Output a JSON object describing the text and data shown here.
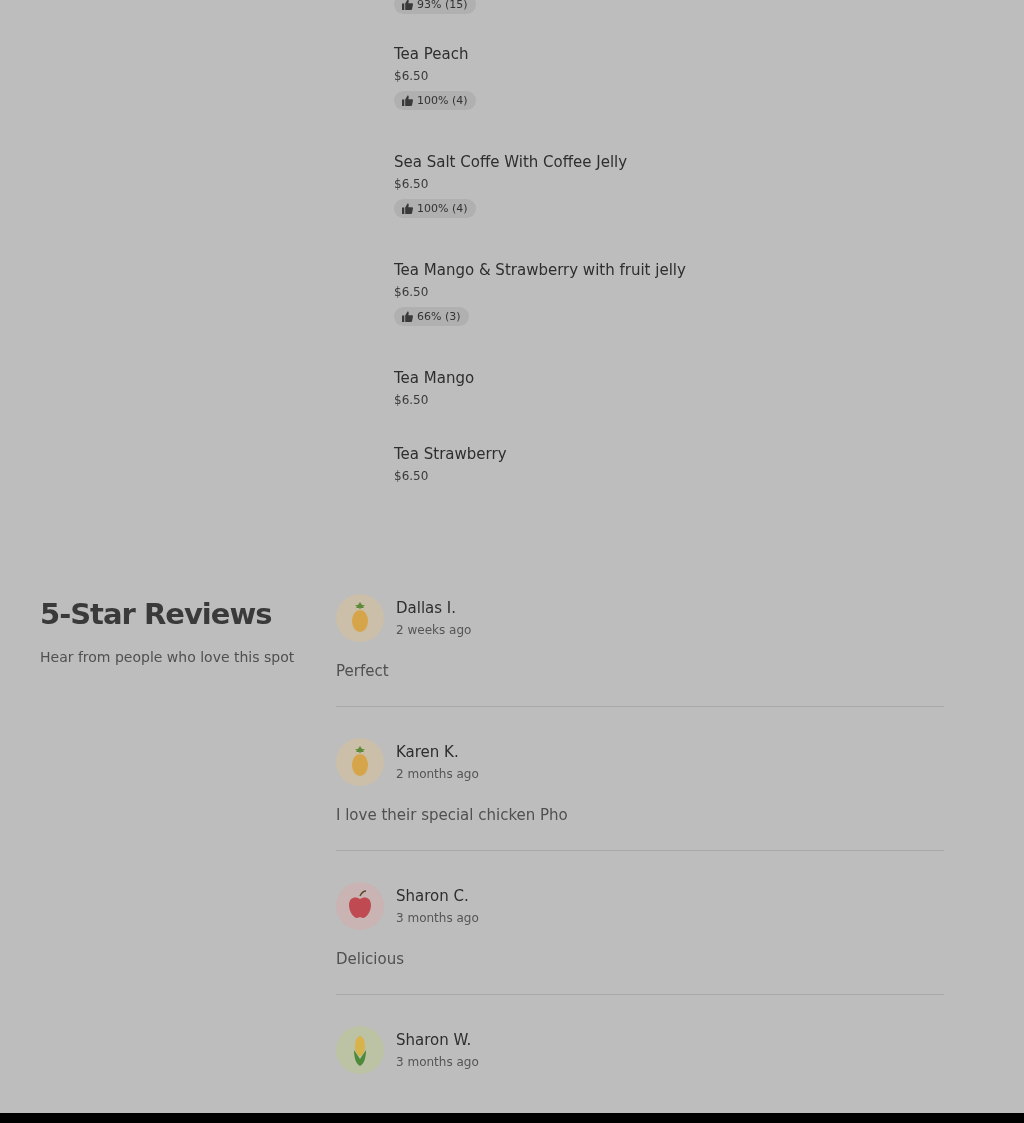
{
  "menu_items": [
    {
      "rating": "93% (15)"
    },
    {
      "name": "Tea Peach",
      "price": "$6.50",
      "rating": "100% (4)"
    },
    {
      "name": "Sea Salt Coffe With Coffee Jelly",
      "price": "$6.50",
      "rating": "100% (4)"
    },
    {
      "name": "Tea Mango & Strawberry with fruit jelly",
      "price": "$6.50",
      "rating": "66% (3)"
    },
    {
      "name": "Tea Mango",
      "price": "$6.50"
    },
    {
      "name": "Tea Strawberry",
      "price": "$6.50"
    }
  ],
  "reviews_section": {
    "title": "5-Star Reviews",
    "subtitle": "Hear from people who love this spot"
  },
  "reviews": [
    {
      "name": "Dallas I.",
      "time": "2 weeks ago",
      "text": "Perfect",
      "kind": "pineapple"
    },
    {
      "name": "Karen K.",
      "time": "2 months ago",
      "text": "I love their special chicken Pho",
      "kind": "pineapple"
    },
    {
      "name": "Sharon C.",
      "time": "3 months ago",
      "text": "Delicious",
      "kind": "apple"
    },
    {
      "name": "Sharon W.",
      "time": "3 months ago",
      "kind": "corn"
    }
  ]
}
